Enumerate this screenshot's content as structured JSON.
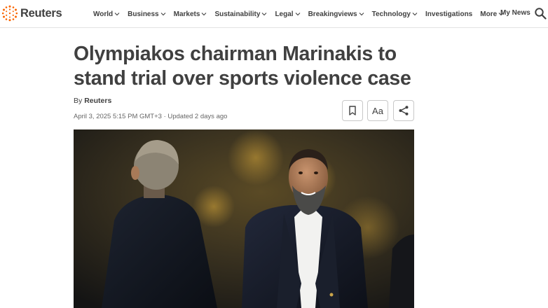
{
  "brand": {
    "name": "Reuters",
    "logo_icon": "reuters-dots-logo",
    "accent_color": "#fa6400"
  },
  "nav": {
    "items": [
      {
        "label": "World",
        "has_dropdown": true
      },
      {
        "label": "Business",
        "has_dropdown": true
      },
      {
        "label": "Markets",
        "has_dropdown": true
      },
      {
        "label": "Sustainability",
        "has_dropdown": true
      },
      {
        "label": "Legal",
        "has_dropdown": true
      },
      {
        "label": "Breakingviews",
        "has_dropdown": true
      },
      {
        "label": "Technology",
        "has_dropdown": true
      },
      {
        "label": "Investigations",
        "has_dropdown": false
      },
      {
        "label": "More",
        "has_dropdown": true
      }
    ],
    "my_news_label": "My News",
    "search_icon": "search-icon"
  },
  "article": {
    "headline": "Olympiakos chairman Marinakis to stand trial over sports violence case",
    "byline_prefix": "By",
    "byline_author": "Reuters",
    "dateline": "April 3, 2025 5:15 PM GMT+3 · Updated 2 days ago",
    "tools": {
      "bookmark_icon": "bookmark-icon",
      "text_size_label": "Aa",
      "share_icon": "share-icon"
    }
  }
}
